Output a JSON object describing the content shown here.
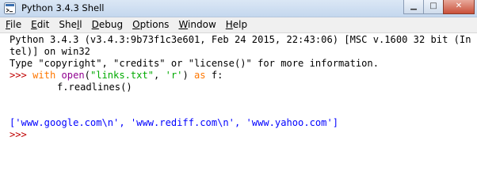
{
  "window": {
    "title": "Python 3.4.3 Shell"
  },
  "menu": [
    {
      "mnemonic": "F",
      "rest": "ile"
    },
    {
      "mnemonic": "E",
      "rest": "dit"
    },
    {
      "pre": "She",
      "mnemonic": "l",
      "rest": "l"
    },
    {
      "mnemonic": "D",
      "rest": "ebug"
    },
    {
      "mnemonic": "O",
      "rest": "ptions"
    },
    {
      "mnemonic": "W",
      "rest": "indow"
    },
    {
      "mnemonic": "H",
      "rest": "elp"
    }
  ],
  "console": {
    "banner_line1": "Python 3.4.3 (v3.4.3:9b73f1c3e601, Feb 24 2015, 22:43:06) [MSC v.1600 32 bit (In",
    "banner_line2": "tel)] on win32",
    "banner_line3": "Type \"copyright\", \"credits\" or \"license()\" for more information.",
    "prompt": ">>>",
    "input1": {
      "kw_with": "with",
      "bi_open": "open",
      "paren_open": "(",
      "str_file": "\"links.txt\"",
      "comma": ", ",
      "str_mode": "'r'",
      "paren_close": ")",
      "kw_as": "as",
      "tail": " f:"
    },
    "input2": "f.readlines()",
    "output": "['www.google.com\\n', 'www.rediff.com\\n', 'www.yahoo.com']",
    "prompt_final": ">>>"
  },
  "colors": {
    "prompt": "#c00000",
    "keyword": "#ff7700",
    "builtin": "#900090",
    "string": "#00aa00",
    "output": "#0000ff"
  },
  "icons": [
    "python-shell-icon",
    "minimize-icon",
    "maximize-icon",
    "close-icon"
  ]
}
